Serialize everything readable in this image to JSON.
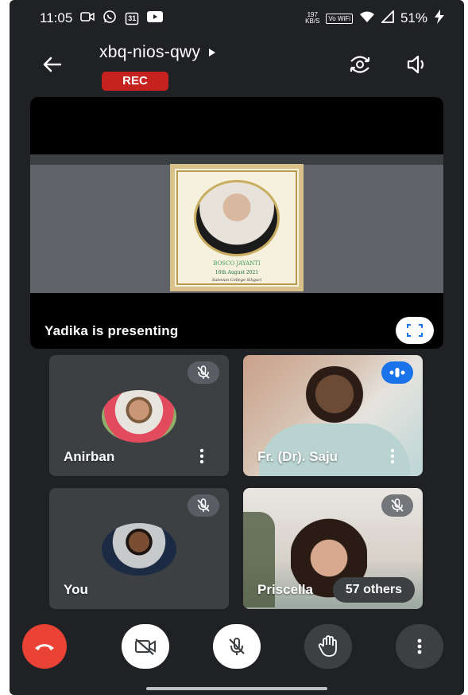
{
  "status_bar": {
    "time": "11:05",
    "calendar_day": "31",
    "net_speed_value": "197",
    "net_speed_unit": "KB/S",
    "volte_label": "Vo WiFi",
    "battery_percent": "51%"
  },
  "header": {
    "meeting_code": "xbq-nios-qwy",
    "rec_label": "REC"
  },
  "presentation": {
    "presenter_text": "Yadika  is presenting",
    "slide": {
      "line1": "BOSCO JAYANTI",
      "line2": "16th August 2021",
      "line3": "Salesian College Siliguri"
    },
    "colors": {
      "card_text_green": "#3b9a57",
      "card_frame": "#d8c28a"
    }
  },
  "participants": [
    {
      "name": "Anirban",
      "muted": true
    },
    {
      "name": "Fr. (Dr). Saju",
      "speaking": true
    },
    {
      "name": "You",
      "muted": true
    },
    {
      "name": "Priscella",
      "muted": true
    }
  ],
  "others_label": "57 others",
  "controls": {
    "end_call_color": "#ea4335",
    "icons": [
      "end-call-icon",
      "camera-off-icon",
      "mic-off-icon",
      "raise-hand-icon",
      "more-vert-icon"
    ]
  }
}
